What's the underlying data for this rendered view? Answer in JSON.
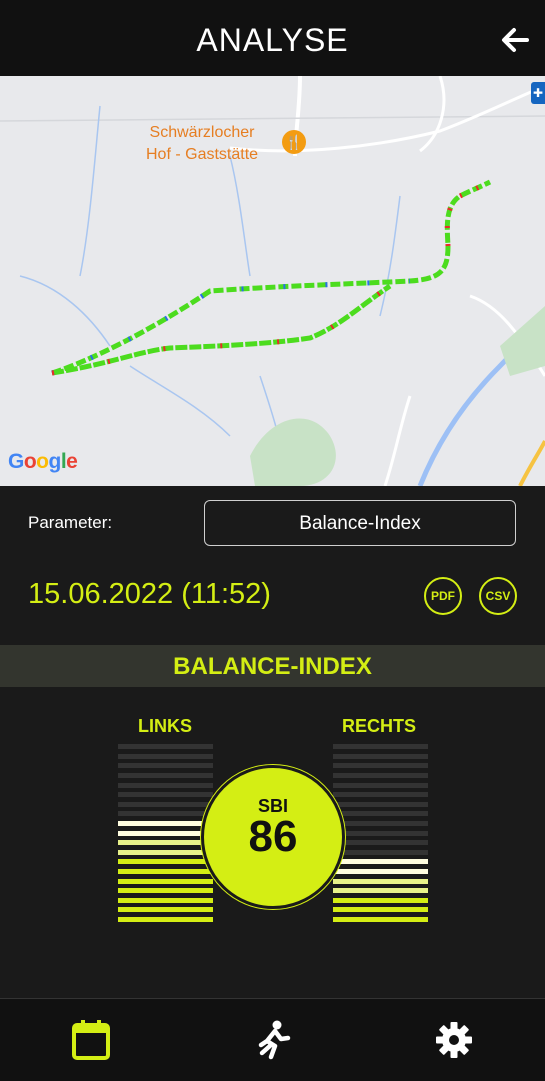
{
  "header": {
    "title": "ANALYSE"
  },
  "map": {
    "poi_line1": "Schwärzlocher",
    "poi_line2": "Hof - Gaststätte",
    "google_g1": "G",
    "google_o1": "o",
    "google_o2": "o",
    "google_g2": "g",
    "google_l": "l",
    "google_e": "e"
  },
  "parameter": {
    "label": "Parameter:",
    "value": "Balance-Index"
  },
  "session": {
    "date": "15.06.2022 (11:52)",
    "pdf_label": "PDF",
    "csv_label": "CSV"
  },
  "balance": {
    "title": "BALANCE-INDEX",
    "left_label": "LINKS",
    "right_label": "RECHTS",
    "sbi_label": "SBI",
    "sbi_value": "86",
    "left_level": 0.58,
    "right_level": 0.37
  },
  "colors": {
    "accent": "#d4ee14",
    "highlight": "#fffde0",
    "track_green": "#4cdc1e"
  },
  "nav": {
    "items": [
      "calendar-icon",
      "runner-icon",
      "gear-icon"
    ]
  }
}
